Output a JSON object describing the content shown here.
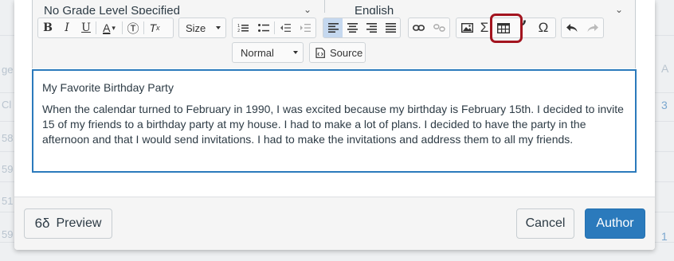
{
  "selects": {
    "grade_level": "No Grade Level Specified",
    "language": "English"
  },
  "toolbar": {
    "size_label": "Size",
    "format_label": "Normal",
    "source_label": "Source"
  },
  "background": {
    "left_fragments": [
      "ge",
      "Cl",
      "58",
      "59",
      "51",
      "59"
    ],
    "right_fragments": [
      "A",
      "3",
      "1"
    ]
  },
  "content": {
    "title": "My Favorite Birthday Party",
    "paragraph": "When the calendar turned to February in 1990, I was excited because my birthday is February 15th. I decided to invite 15 of my friends to a birthday party at my house. I had to make a lot of plans. I decided to have the party in the afternoon and that I would send invitations. I had to make the invitations and address them to all my friends."
  },
  "footer": {
    "preview_label": "Preview",
    "cancel_label": "Cancel",
    "author_label": "Author"
  },
  "colors": {
    "accent": "#2b7abc",
    "highlight": "#a3141f"
  }
}
